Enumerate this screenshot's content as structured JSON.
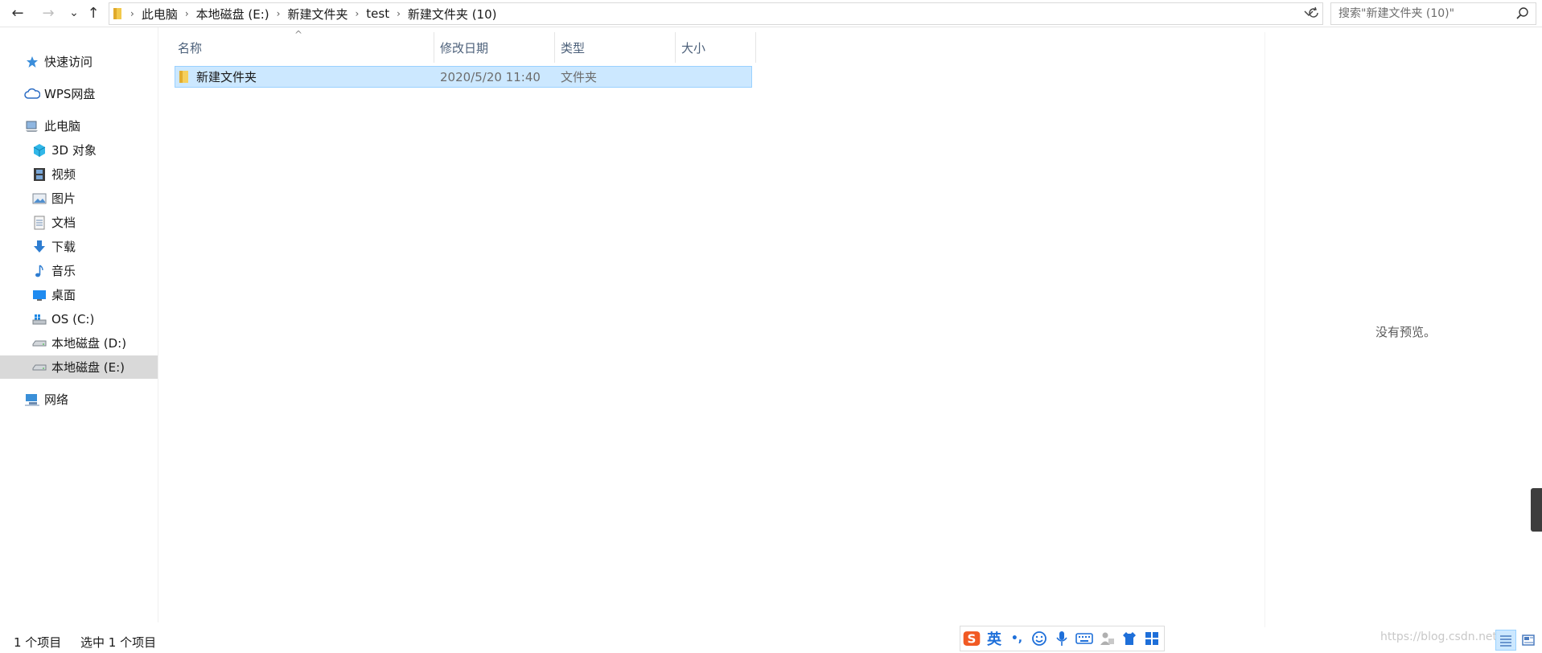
{
  "nav_buttons": {
    "back": "←",
    "forward": "→",
    "recent": "⌄",
    "up": "↑"
  },
  "breadcrumb": [
    "此电脑",
    "本地磁盘 (E:)",
    "新建文件夹",
    "test",
    "新建文件夹 (10)"
  ],
  "search": {
    "placeholder": "搜索\"新建文件夹 (10)\""
  },
  "sidebar": {
    "items": [
      {
        "label": "快速访问",
        "icon": "star-icon"
      },
      {
        "label": "WPS网盘",
        "icon": "cloud-icon"
      },
      {
        "label": "此电脑",
        "icon": "computer-icon"
      },
      {
        "label": "3D 对象",
        "icon": "cube-icon"
      },
      {
        "label": "视频",
        "icon": "film-icon"
      },
      {
        "label": "图片",
        "icon": "picture-icon"
      },
      {
        "label": "文档",
        "icon": "document-icon"
      },
      {
        "label": "下载",
        "icon": "download-icon"
      },
      {
        "label": "音乐",
        "icon": "music-icon"
      },
      {
        "label": "桌面",
        "icon": "desktop-icon"
      },
      {
        "label": "OS (C:)",
        "icon": "windows-drive-icon"
      },
      {
        "label": "本地磁盘 (D:)",
        "icon": "drive-icon"
      },
      {
        "label": "本地磁盘 (E:)",
        "icon": "drive-icon",
        "selected": true
      },
      {
        "label": "网络",
        "icon": "network-icon"
      }
    ]
  },
  "columns": [
    "名称",
    "修改日期",
    "类型",
    "大小"
  ],
  "files": [
    {
      "name": "新建文件夹",
      "modified": "2020/5/20 11:40",
      "type": "文件夹",
      "size": ""
    }
  ],
  "preview": {
    "text": "没有预览。"
  },
  "status": {
    "item_count": "1 个项目",
    "selected_count": "选中 1 个项目"
  },
  "ime": {
    "mode": "英",
    "punct": "•,",
    "icons": [
      "sogou-logo-icon",
      "lang-mode-icon",
      "punctuation-icon",
      "emoji-icon",
      "microphone-icon",
      "keyboard-icon",
      "user-icon",
      "skin-shirt-icon",
      "toolbox-icon"
    ]
  },
  "watermark": "https://blog.csdn.net/...",
  "colors": {
    "selection_bg": "#cce8ff",
    "selection_border": "#99d1ff",
    "header_text": "#4c607a",
    "accent": "#1e6fd9"
  }
}
